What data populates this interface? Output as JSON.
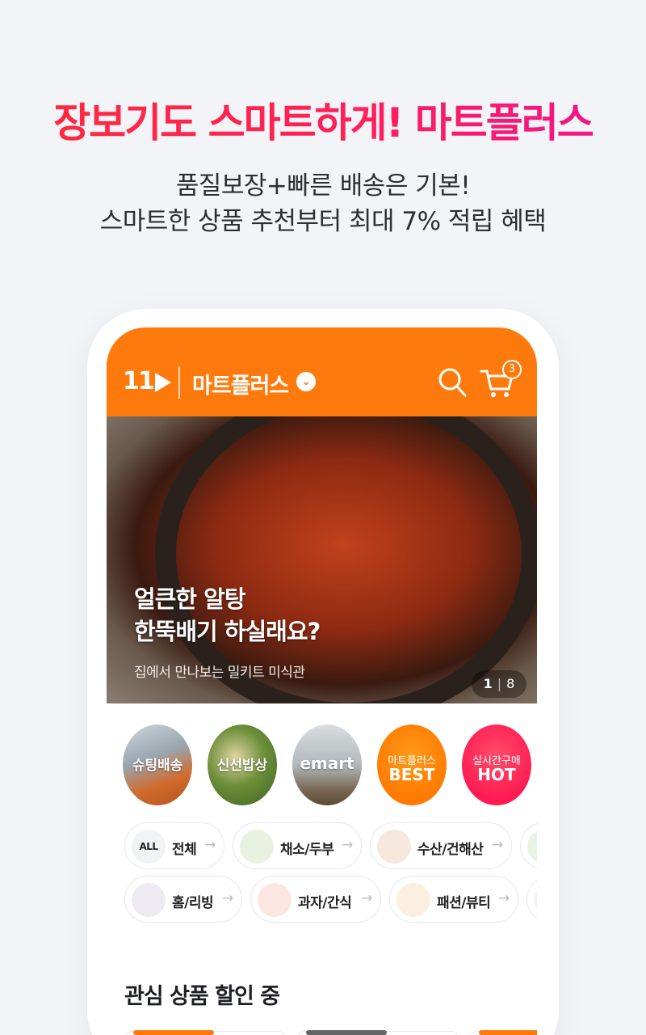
{
  "promo": {
    "headline": "장보기도 스마트하게! 마트플러스",
    "sub_line1": "품질보장+빠른 배송은 기본!",
    "sub_line2": "스마트한 상품 추천부터 최대 7% 적립 혜택"
  },
  "appbar": {
    "logo": "11",
    "title": "마트플러스",
    "dropdown_icon": "chevron-down-icon",
    "search_icon": "search-icon",
    "cart_icon": "cart-icon",
    "cart_count": "3"
  },
  "hero": {
    "title_line1": "얼큰한 알탕",
    "title_line2": "한뚝배기 하실래요?",
    "subtitle": "집에서 만나보는 밀키트 미식관",
    "page_current": "1",
    "page_total": "8"
  },
  "shortcuts": [
    {
      "label": "슈팅배송"
    },
    {
      "label": "신선밥상"
    },
    {
      "label": "emart"
    },
    {
      "label_top": "마트플러스",
      "label_bottom": "BEST"
    },
    {
      "label_top": "실시간구매",
      "label_bottom": "HOT"
    }
  ],
  "categories_row1": [
    {
      "icon_text": "ALL",
      "label": "전체"
    },
    {
      "icon_text": "",
      "label": "채소/두부"
    },
    {
      "icon_text": "",
      "label": "수산/건해산"
    }
  ],
  "categories_row2": [
    {
      "icon_text": "",
      "label": "홈/리빙"
    },
    {
      "icon_text": "",
      "label": "과자/간식"
    },
    {
      "icon_text": "",
      "label": "패션/뷰티"
    }
  ],
  "arrow_glyph": "→",
  "section": {
    "title": "관심 상품 할인 중"
  },
  "colors": {
    "brand_orange": "#ff7a0c",
    "headline_red": "#ff2a3b",
    "headline_pink": "#f0138e"
  }
}
